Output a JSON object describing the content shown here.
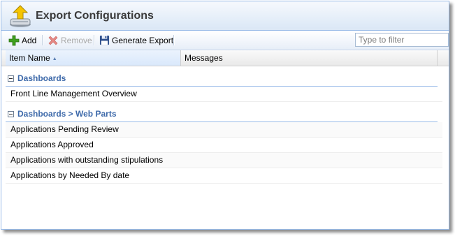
{
  "header": {
    "title": "Export Configurations",
    "icon": "export-upload-icon"
  },
  "toolbar": {
    "add_label": "Add",
    "remove_label": "Remove",
    "remove_enabled": false,
    "generate_label": "Generate Export",
    "filter_placeholder": "Type to filter",
    "filter_value": ""
  },
  "grid": {
    "columns": [
      {
        "label": "Item Name",
        "sorted": "ascending"
      },
      {
        "label": "Messages"
      }
    ],
    "groups": [
      {
        "title": "Dashboards",
        "rows": [
          {
            "item_name": "Front Line Management Overview",
            "messages": ""
          }
        ]
      },
      {
        "title": "Dashboards > Web Parts",
        "rows": [
          {
            "item_name": "Applications Pending Review",
            "messages": ""
          },
          {
            "item_name": "Applications Approved",
            "messages": ""
          },
          {
            "item_name": "Applications with outstanding stipulations",
            "messages": ""
          },
          {
            "item_name": "Applications by Needed By date",
            "messages": ""
          }
        ]
      }
    ]
  },
  "colors": {
    "group_title": "#3e6aaa",
    "border": "#99bbe8",
    "add_icon": "#3fa01e",
    "remove_icon": "#d9534f"
  }
}
